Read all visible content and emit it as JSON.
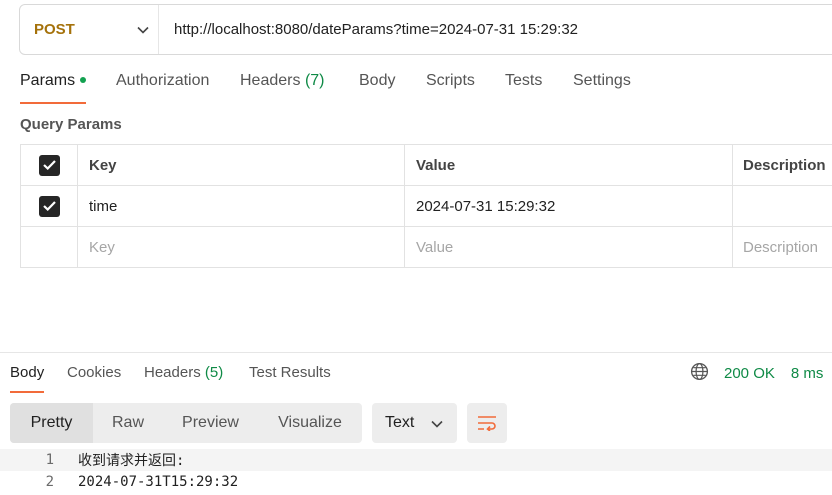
{
  "request": {
    "method": "POST",
    "url": "http://localhost:8080/dateParams?time=2024-07-31 15:29:32"
  },
  "request_tabs": [
    {
      "label": "Params",
      "active": true,
      "dot": true
    },
    {
      "label": "Authorization"
    },
    {
      "label": "Headers",
      "count": "(7)"
    },
    {
      "label": "Body"
    },
    {
      "label": "Scripts"
    },
    {
      "label": "Tests"
    },
    {
      "label": "Settings"
    }
  ],
  "params": {
    "section_title": "Query Params",
    "headers": {
      "key": "Key",
      "value": "Value",
      "description": "Description"
    },
    "rows": [
      {
        "checked": true,
        "key": "time",
        "value": "2024-07-31 15:29:32",
        "description": ""
      }
    ],
    "placeholder": {
      "key": "Key",
      "value": "Value",
      "description": "Description"
    }
  },
  "response": {
    "tabs": [
      {
        "label": "Body",
        "active": true
      },
      {
        "label": "Cookies"
      },
      {
        "label": "Headers",
        "count": "(5)"
      },
      {
        "label": "Test Results"
      }
    ],
    "status": "200 OK",
    "time": "8 ms",
    "view_modes": [
      "Pretty",
      "Raw",
      "Preview",
      "Visualize"
    ],
    "format": "Text",
    "lines": [
      {
        "num": "1",
        "text": "收到请求并返回:"
      },
      {
        "num": "2",
        "text": "2024-07-31T15:29:32"
      }
    ]
  },
  "colors": {
    "accent": "#f26b3a",
    "method": "#a5720b",
    "success": "#0f8a46"
  },
  "icons": [
    "chevron-down-icon",
    "check-icon",
    "globe-icon",
    "wrap-lines-icon"
  ]
}
